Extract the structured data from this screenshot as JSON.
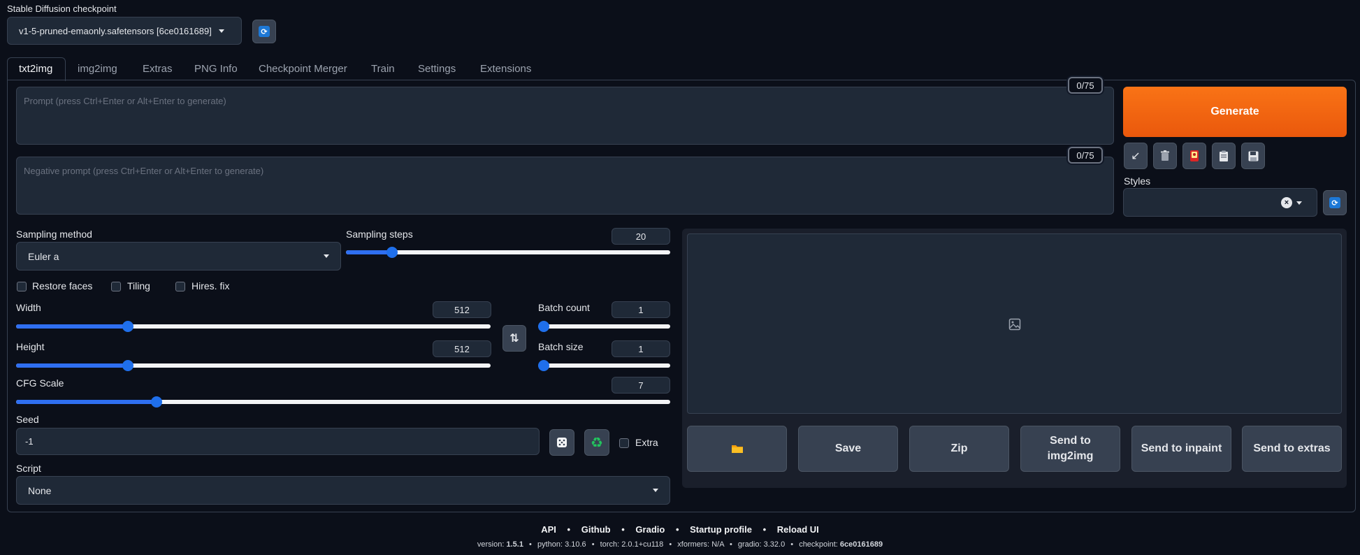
{
  "checkpoint": {
    "label": "Stable Diffusion checkpoint",
    "value": "v1-5-pruned-emaonly.safetensors [6ce0161689]"
  },
  "tabs": [
    "txt2img",
    "img2img",
    "Extras",
    "PNG Info",
    "Checkpoint Merger",
    "Train",
    "Settings",
    "Extensions"
  ],
  "prompt": {
    "placeholder": "Prompt (press Ctrl+Enter or Alt+Enter to generate)",
    "counter": "0/75"
  },
  "negative_prompt": {
    "placeholder": "Negative prompt (press Ctrl+Enter or Alt+Enter to generate)",
    "counter": "0/75"
  },
  "generate_label": "Generate",
  "styles_label": "Styles",
  "sampling": {
    "method_label": "Sampling method",
    "method_value": "Euler a",
    "steps_label": "Sampling steps",
    "steps_value": "20",
    "steps_fraction": 0.13
  },
  "checkboxes": {
    "restore_faces": "Restore faces",
    "tiling": "Tiling",
    "hires_fix": "Hires. fix"
  },
  "width": {
    "label": "Width",
    "value": "512",
    "fraction": 0.23
  },
  "height": {
    "label": "Height",
    "value": "512",
    "fraction": 0.23
  },
  "batch_count": {
    "label": "Batch count",
    "value": "1",
    "fraction": 0.0
  },
  "batch_size": {
    "label": "Batch size",
    "value": "1",
    "fraction": 0.0
  },
  "cfg": {
    "label": "CFG Scale",
    "value": "7",
    "fraction": 0.21
  },
  "seed": {
    "label": "Seed",
    "value": "-1",
    "extra_label": "Extra"
  },
  "script": {
    "label": "Script",
    "value": "None"
  },
  "output_buttons": {
    "save": "Save",
    "zip": "Zip",
    "send_img2img": "Send to img2img",
    "send_inpaint": "Send to inpaint",
    "send_extras": "Send to extras"
  },
  "footer": {
    "links": [
      "API",
      "Github",
      "Gradio",
      "Startup profile",
      "Reload UI"
    ],
    "version_label": "version:",
    "version": "1.5.1",
    "python_label": "python:",
    "python": "3.10.6",
    "torch_label": "torch:",
    "torch": "2.0.1+cu118",
    "xformers_label": "xformers:",
    "xformers": "N/A",
    "gradio_label": "gradio:",
    "gradio": "3.32.0",
    "checkpoint_label": "checkpoint:",
    "checkpoint": "6ce0161689"
  },
  "colors": {
    "generate": "#ea580c",
    "accent": "#1f6feb",
    "background": "#0b0f19"
  },
  "icons": {
    "refresh": "refresh-icon",
    "arrow": "arrow-down-left-icon",
    "trash": "trash-icon",
    "red_card": "extra-networks-icon",
    "clipboard": "clipboard-icon",
    "floppy": "save-style-icon",
    "swap": "swap-icon",
    "dice": "dice-icon",
    "recycle": "recycle-icon",
    "folder": "folder-icon",
    "image": "image-placeholder-icon"
  }
}
